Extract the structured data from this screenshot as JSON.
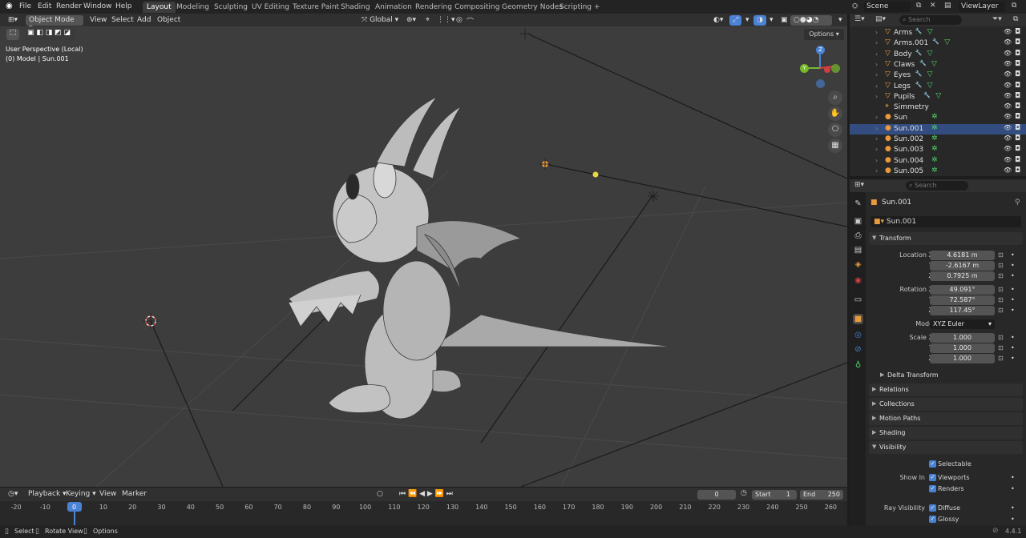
{
  "topbar": {
    "menus": [
      "File",
      "Edit",
      "Render",
      "Window",
      "Help"
    ],
    "workspaces": [
      "Layout",
      "Modeling",
      "Sculpting",
      "UV Editing",
      "Texture Paint",
      "Shading",
      "Animation",
      "Rendering",
      "Compositing",
      "Geometry Nodes",
      "Scripting"
    ],
    "active_workspace": "Layout",
    "add_tab": "+",
    "scene": "Scene",
    "view_layer": "ViewLayer"
  },
  "viewport_header": {
    "mode": "Object Mode",
    "menus": [
      "View",
      "Select",
      "Add",
      "Object"
    ],
    "orientation": "Global",
    "options": "Options"
  },
  "viewport": {
    "view_name": "User Perspective (Local)",
    "object_info": "(0) Model | Sun.001",
    "gizmo_z": "Z",
    "gizmo_y": "Y",
    "gizmo_x": "X"
  },
  "outliner": {
    "search_placeholder": "Search",
    "items": [
      {
        "name": "Arms",
        "type": "mesh"
      },
      {
        "name": "Arms.001",
        "type": "mesh"
      },
      {
        "name": "Body",
        "type": "mesh"
      },
      {
        "name": "Claws",
        "type": "mesh"
      },
      {
        "name": "Eyes",
        "type": "mesh"
      },
      {
        "name": "Legs",
        "type": "mesh"
      },
      {
        "name": "Pupils",
        "type": "mesh"
      },
      {
        "name": "Simmetry",
        "type": "empty"
      },
      {
        "name": "Sun",
        "type": "light"
      },
      {
        "name": "Sun.001",
        "type": "light"
      },
      {
        "name": "Sun.002",
        "type": "light"
      },
      {
        "name": "Sun.003",
        "type": "light"
      },
      {
        "name": "Sun.004",
        "type": "light"
      },
      {
        "name": "Sun.005",
        "type": "light"
      }
    ]
  },
  "properties": {
    "search_placeholder": "Search",
    "object_name": "Sun.001",
    "datablock_name": "Sun.001",
    "transform": {
      "title": "Transform",
      "location_label": "Location X",
      "location": [
        "4.6181 m",
        "-2.6167 m",
        "0.7925 m"
      ],
      "rotation_label": "Rotation X",
      "rotation": [
        "49.091°",
        "72.587°",
        "117.45°"
      ],
      "mode_label": "Mode",
      "mode": "XYZ Euler",
      "scale_label": "Scale X",
      "scale": [
        "1.000",
        "1.000",
        "1.000"
      ],
      "y": "Y",
      "z": "Z"
    },
    "delta_transform": "Delta Transform",
    "panels": [
      "Relations",
      "Collections",
      "Motion Paths",
      "Shading",
      "Visibility"
    ],
    "visibility": {
      "selectable": "Selectable",
      "show_in_label": "Show In",
      "viewports": "Viewports",
      "renders": "Renders",
      "ray_visibility_label": "Ray Visibility",
      "diffuse": "Diffuse",
      "glossy": "Glossy"
    }
  },
  "timeline": {
    "menus": [
      "Playback",
      "Keying",
      "View",
      "Marker"
    ],
    "current_frame": "0",
    "start_label": "Start",
    "start": "1",
    "end_label": "End",
    "end": "250",
    "ticks": [
      "-20",
      "-10",
      "0",
      "10",
      "20",
      "30",
      "40",
      "50",
      "60",
      "70",
      "80",
      "90",
      "100",
      "110",
      "120",
      "130",
      "140",
      "150",
      "160",
      "170",
      "180",
      "190",
      "200",
      "210",
      "220",
      "230",
      "240",
      "250",
      "260"
    ]
  },
  "statusbar": {
    "select": "Select",
    "rotate_view": "Rotate View",
    "options": "Options",
    "version": "4.4.1"
  },
  "colors": {
    "accent": "#4a82d4",
    "active_tab": "#3d3d3d",
    "light_icon": "#e89a3c",
    "mesh_icon": "#e89a3c",
    "modifier_icon": "#6ec8ff",
    "data_icon": "#4fd66a",
    "viewport_bg": "#3d3d3d"
  }
}
